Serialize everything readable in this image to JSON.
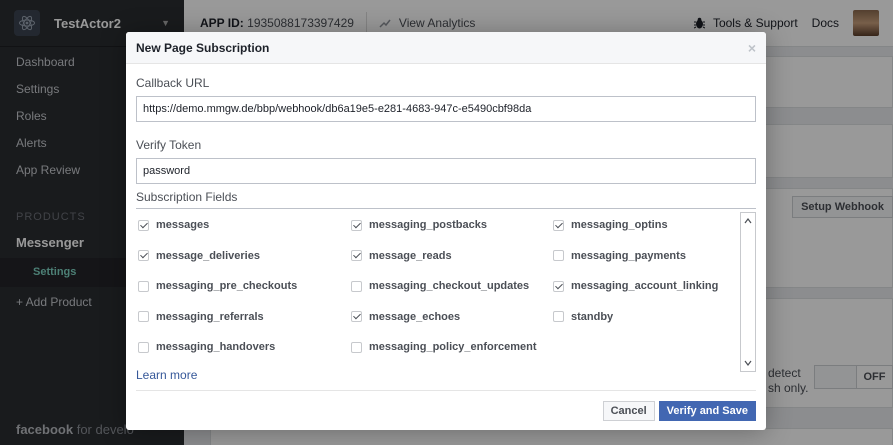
{
  "sidebar": {
    "app_name": "TestActor2",
    "items": [
      "Dashboard",
      "Settings",
      "Roles",
      "Alerts",
      "App Review"
    ],
    "section_label": "PRODUCTS",
    "product": "Messenger",
    "product_sub": "Settings",
    "add_product": "+ Add Product",
    "footer_brand": "facebook",
    "footer_suffix": "for develo"
  },
  "topbar": {
    "app_id_label": "APP ID:",
    "app_id": "1935088173397429",
    "analytics": "View Analytics",
    "tools": "Tools & Support",
    "docs": "Docs"
  },
  "background": {
    "setup_webhooks": "Setup Webhook",
    "detect_text": "detect",
    "sh_only_text": "sh only.",
    "toggle_off": "OFF"
  },
  "modal": {
    "title": "New Page Subscription",
    "close": "×",
    "callback_label": "Callback URL",
    "callback_value": "https://demo.mmgw.de/bbp/webhook/db6a19e5-e281-4683-947c-e5490cbf98da",
    "verify_label": "Verify Token",
    "verify_value": "password",
    "fields_label": "Subscription Fields",
    "fields": [
      {
        "name": "messages",
        "checked": true
      },
      {
        "name": "messaging_postbacks",
        "checked": true
      },
      {
        "name": "messaging_optins",
        "checked": true
      },
      {
        "name": "message_deliveries",
        "checked": true
      },
      {
        "name": "message_reads",
        "checked": true
      },
      {
        "name": "messaging_payments",
        "checked": false
      },
      {
        "name": "messaging_pre_checkouts",
        "checked": false
      },
      {
        "name": "messaging_checkout_updates",
        "checked": false
      },
      {
        "name": "messaging_account_linking",
        "checked": true
      },
      {
        "name": "messaging_referrals",
        "checked": false
      },
      {
        "name": "message_echoes",
        "checked": true
      },
      {
        "name": "standby",
        "checked": false
      },
      {
        "name": "messaging_handovers",
        "checked": false
      },
      {
        "name": "messaging_policy_enforcement",
        "checked": false
      }
    ],
    "learn_more": "Learn more",
    "cancel": "Cancel",
    "submit": "Verify and Save"
  }
}
